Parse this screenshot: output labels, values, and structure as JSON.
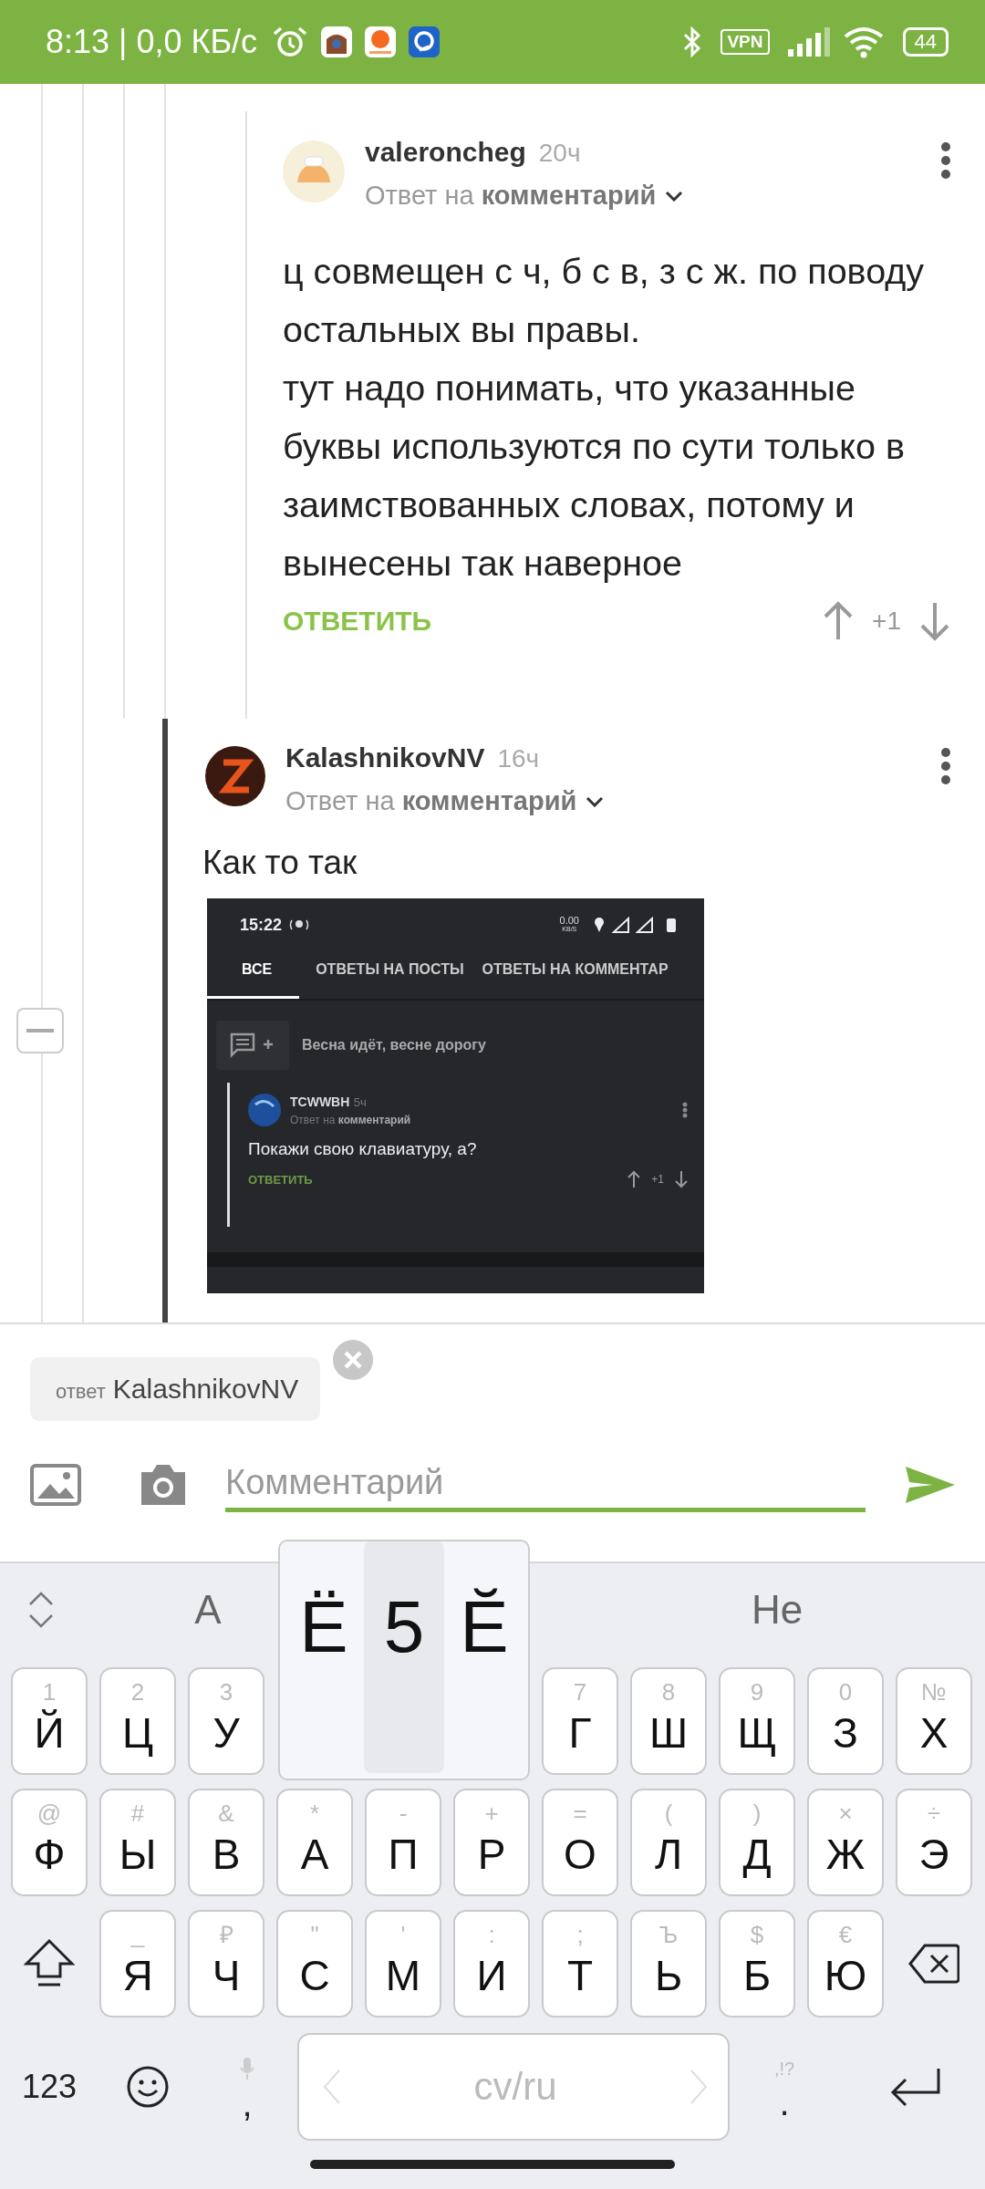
{
  "status_bar": {
    "time": "8:13 | 0,0 КБ/с",
    "vpn": "VPN",
    "battery": "44"
  },
  "comments": [
    {
      "author": "valeroncheg",
      "age": "20ч",
      "reply_to": "Ответ на **комментарий**",
      "text": "ц совмещен с ч, б с в, з с ж. по поводу остальных вы правы.\nтут надо понимать, что указанные буквы используются по сути только в заимствованных словах, потому и вынесены так наверное",
      "reply_button": "ОТВЕТИТЬ",
      "score": "+1"
    },
    {
      "author": "KalashnikovNV",
      "age": "16ч",
      "reply_to": "Ответ на **комментарий**",
      "text": "Как то так",
      "screenshot": {
        "time": "15:22",
        "net_speed": "0.00",
        "net_unit": "KB/S",
        "tabs": [
          {
            "label": "ВСЕ",
            "selected": true
          },
          {
            "label": "ОТВЕТЫ НА ПОСТЫ",
            "selected": false
          },
          {
            "label": "ОТВЕТЫ НА КОММЕНТАР",
            "selected": false
          }
        ],
        "post_title": "Весна идёт, весне дорогу",
        "comment": {
          "author": "TCWWBH",
          "age": "5ч",
          "reply_to": "Ответ на **комментарий**",
          "text": "Покажи свою клавиатуру, а?",
          "reply_button": "ОТВЕТИТЬ",
          "score": "+1"
        }
      }
    }
  ],
  "reply_chip": {
    "prefix": "ответ",
    "name": "KalashnikovNV"
  },
  "comment_field": {
    "placeholder": "Комментарий"
  },
  "suggestions": [
    "А",
    "Не"
  ],
  "popup": [
    {
      "label": "Ё",
      "selected": false
    },
    {
      "label": "5",
      "selected": true
    },
    {
      "label": "Ӗ",
      "selected": false
    }
  ],
  "keyboard": {
    "row_1_left": [
      {
        "hint": "1",
        "label": "Й"
      },
      {
        "hint": "2",
        "label": "Ц"
      },
      {
        "hint": "3",
        "label": "У"
      }
    ],
    "row_1_right": [
      {
        "hint": "7",
        "label": "Г"
      },
      {
        "hint": "8",
        "label": "Ш"
      },
      {
        "hint": "9",
        "label": "Щ"
      },
      {
        "hint": "0",
        "label": "З"
      },
      {
        "hint": "№",
        "label": "Х"
      }
    ],
    "row_2": [
      {
        "hint": "@",
        "label": "Ф"
      },
      {
        "hint": "#",
        "label": "Ы"
      },
      {
        "hint": "&",
        "label": "В"
      },
      {
        "hint": "*",
        "label": "А"
      },
      {
        "hint": "-",
        "label": "П"
      },
      {
        "hint": "+",
        "label": "Р"
      },
      {
        "hint": "=",
        "label": "О"
      },
      {
        "hint": "(",
        "label": "Л"
      },
      {
        "hint": ")",
        "label": "Д"
      },
      {
        "hint": "×",
        "label": "Ж"
      },
      {
        "hint": "÷",
        "label": "Э"
      }
    ],
    "row_3": [
      {
        "hint": "_",
        "label": "Я"
      },
      {
        "hint": "₽",
        "label": "Ч"
      },
      {
        "hint": "\"",
        "label": "С"
      },
      {
        "hint": "'",
        "label": "М"
      },
      {
        "hint": ":",
        "label": "И"
      },
      {
        "hint": ";",
        "label": "Т"
      },
      {
        "hint": "Ъ",
        "label": "Ь"
      },
      {
        "hint": "$",
        "label": "Б"
      },
      {
        "hint": "€",
        "label": "Ю"
      }
    ],
    "numbers_key": "123",
    "comma_key": ",",
    "space_key": "cv/ru",
    "period_key": ".",
    "period_hint": ",!?"
  }
}
